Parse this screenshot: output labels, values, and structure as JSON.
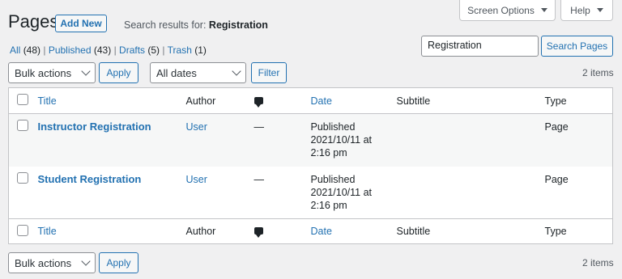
{
  "header": {
    "page_title": "Pages",
    "add_new": "Add New",
    "search_results_prefix": "Search results for:",
    "search_query": "Registration",
    "screen_options": "Screen Options",
    "help": "Help"
  },
  "filters": {
    "views": [
      {
        "label": "All",
        "count": "(48)"
      },
      {
        "label": "Published",
        "count": "(43)"
      },
      {
        "label": "Drafts",
        "count": "(5)"
      },
      {
        "label": "Trash",
        "count": "(1)"
      }
    ],
    "bulk_actions": "Bulk actions",
    "apply": "Apply",
    "date_filter": "All dates",
    "filter": "Filter",
    "items_count": "2 items"
  },
  "search": {
    "value": "Registration",
    "button": "Search Pages"
  },
  "table": {
    "columns": {
      "title": "Title",
      "author": "Author",
      "date": "Date",
      "subtitle": "Subtitle",
      "type": "Type"
    },
    "rows": [
      {
        "title": "Instructor Registration",
        "author": "User",
        "comments": "—",
        "date_status": "Published",
        "date_line1": "2021/10/11 at",
        "date_line2": "2:16 pm",
        "subtitle": "",
        "type": "Page"
      },
      {
        "title": "Student Registration",
        "author": "User",
        "comments": "—",
        "date_status": "Published",
        "date_line1": "2021/10/11 at",
        "date_line2": "2:16 pm",
        "subtitle": "",
        "type": "Page"
      }
    ]
  },
  "icons": {
    "comments": "comment-bubble-icon",
    "dropdown": "chevron-down-icon"
  },
  "colors": {
    "accent": "#2271b1",
    "background": "#f0f0f1",
    "border": "#c3c4c7"
  }
}
